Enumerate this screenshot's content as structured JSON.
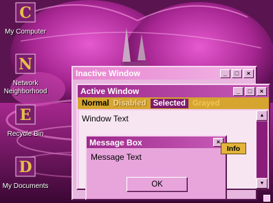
{
  "desktop": {
    "icons": [
      {
        "name": "my-computer",
        "label": "My Computer",
        "glyph": "C"
      },
      {
        "name": "network-neighborhood",
        "label": "Network\nNeighborhood",
        "glyph": "N"
      },
      {
        "name": "recycle-bin",
        "label": "Recycle Bin",
        "glyph": "E"
      },
      {
        "name": "my-documents",
        "label": "My Documents",
        "glyph": "D"
      }
    ]
  },
  "inactive_window": {
    "title": "Inactive Window"
  },
  "active_window": {
    "title": "Active Window",
    "menu": {
      "normal": "Normal",
      "disabled": "Disabled",
      "selected": "Selected",
      "grayed": "Grayed"
    },
    "text": "Window Text"
  },
  "message_box": {
    "title": "Message Box",
    "text": "Message Text",
    "ok_label": "OK"
  },
  "tooltip": {
    "text": "Info"
  },
  "window_controls": {
    "minimize": "_",
    "maximize": "□",
    "close": "×"
  },
  "scrollbar": {
    "up": "▲",
    "down": "▼"
  },
  "colors": {
    "active_title": "#9d2a8c",
    "inactive_title": "#e783cf",
    "menu_bar": "#d5a52f",
    "selection": "#7e1a6e",
    "window_bg": "#f7e6f2"
  },
  "icon_names": [
    "minimize-icon",
    "maximize-icon",
    "close-icon",
    "scroll-up-icon",
    "scroll-down-icon"
  ]
}
